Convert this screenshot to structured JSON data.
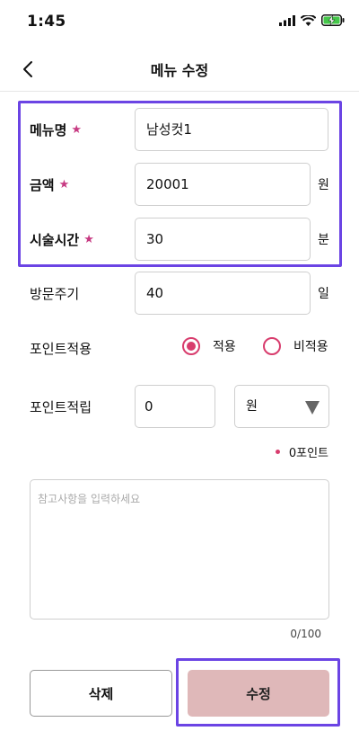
{
  "status_bar": {
    "time": "1:45"
  },
  "header": {
    "title": "메뉴 수정"
  },
  "form": {
    "menu_name": {
      "label": "메뉴명",
      "value": "남성컷1"
    },
    "price": {
      "label": "금액",
      "value": "20001",
      "unit": "원"
    },
    "duration": {
      "label": "시술시간",
      "value": "30",
      "unit": "분"
    },
    "visit_cycle": {
      "label": "방문주기",
      "value": "40",
      "unit": "일"
    },
    "point_apply": {
      "label": "포인트적용",
      "options": [
        "적용",
        "비적용"
      ],
      "selected": "적용"
    },
    "point_earn": {
      "label": "포인트적립",
      "value": "0",
      "unit_selected": "원"
    },
    "points_total": "0포인트",
    "memo": {
      "placeholder": "참고사항을 입력하세요",
      "char_count": "0/100"
    }
  },
  "buttons": {
    "delete": "삭제",
    "submit": "수정"
  },
  "colors": {
    "accent": "#d83c6d",
    "required_star": "#c73a82",
    "submit_bg": "#dfb8b9",
    "highlight_border": "#6b44e4"
  }
}
